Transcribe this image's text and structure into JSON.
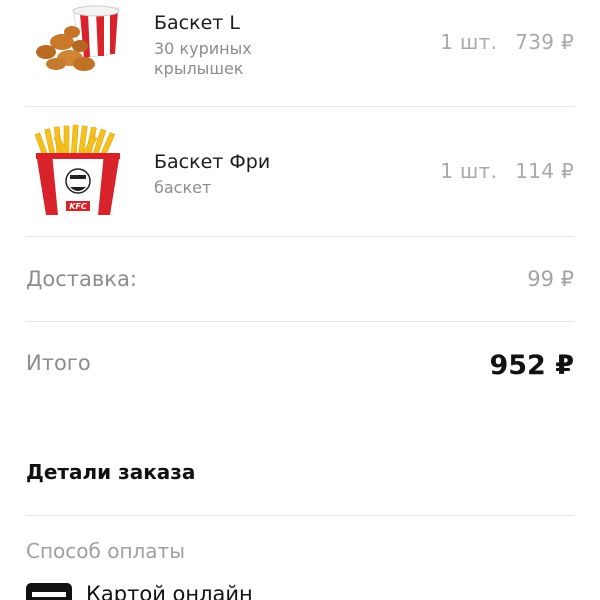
{
  "order_items": [
    {
      "name": "Баскет L",
      "description_line1": "30 куриных",
      "description_line2": "крылышек",
      "quantity": "1 шт.",
      "price": "739 ₽",
      "image_icon": "chicken-wings-bucket-icon"
    },
    {
      "name": "Баскет Фри",
      "description_line1": "баскет",
      "quantity": "1 шт.",
      "price": "114 ₽",
      "image_icon": "fries-bucket-icon",
      "logo_text": "KFC"
    }
  ],
  "delivery": {
    "label": "Доставка:",
    "value": "99 ₽"
  },
  "total": {
    "label": "Итого",
    "value": "952 ₽"
  },
  "order_details": {
    "title": "Детали заказа"
  },
  "payment": {
    "label": "Способ оплаты",
    "selected_option": "Картой онлайн",
    "option_icon": "credit-card-icon"
  },
  "colors": {
    "bucket_red": "#d8232a",
    "fries_yellow": "#f5c01e",
    "chicken_brown": "#c9792b",
    "divider": "#e4e4e4",
    "muted_text": "#a9a9a9"
  }
}
